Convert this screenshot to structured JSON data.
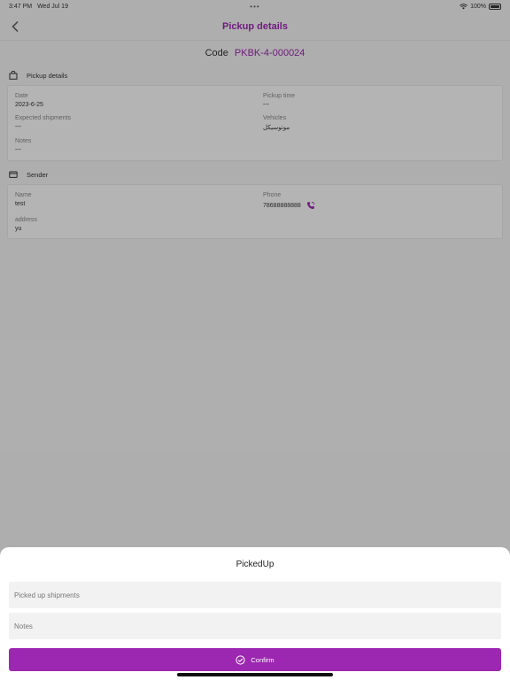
{
  "status_bar": {
    "time": "3:47 PM",
    "date": "Wed Jul 19",
    "dots": "•••",
    "battery": "100%"
  },
  "nav": {
    "title": "Pickup details"
  },
  "code": {
    "label": "Code",
    "value": "PKBK-4-000024"
  },
  "pickup_section": {
    "title": "Pickup details",
    "date_label": "Date",
    "date_value": "2023-6-25",
    "pickup_time_label": "Pickup time",
    "pickup_time_value": "---",
    "expected_label": "Expected shipments",
    "expected_value": "---",
    "vehicles_label": "Vehicles",
    "vehicles_value": "موتوسيكل",
    "notes_label": "Notes",
    "notes_value": "---"
  },
  "sender_section": {
    "title": "Sender",
    "name_label": "Name",
    "name_value": "test",
    "phone_label": "Phone",
    "phone_value": "78688888888",
    "address_label": "address",
    "address_value": "yu"
  },
  "sheet": {
    "title": "PickedUp",
    "shipments_placeholder": "Picked up shipments",
    "notes_placeholder": "Notes",
    "confirm_label": "Confirm"
  },
  "colors": {
    "accent": "#9c27b0"
  }
}
